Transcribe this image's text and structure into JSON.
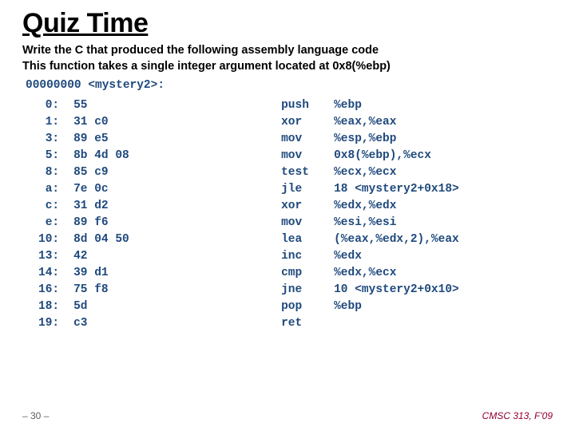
{
  "title": "Quiz Time",
  "intro": {
    "line1": "Write the C that produced the following assembly language code",
    "line2": "This function takes a single integer argument located at 0x8(%ebp)"
  },
  "symbol": "00000000 <mystery2>:",
  "asm": [
    {
      "off": "0:",
      "bytes": "55",
      "mnem": "push",
      "oper": "%ebp"
    },
    {
      "off": "1:",
      "bytes": "31 c0",
      "mnem": "xor",
      "oper": "%eax,%eax"
    },
    {
      "off": "3:",
      "bytes": "89 e5",
      "mnem": "mov",
      "oper": "%esp,%ebp"
    },
    {
      "off": "5:",
      "bytes": "8b 4d 08",
      "mnem": "mov",
      "oper": "0x8(%ebp),%ecx"
    },
    {
      "off": "8:",
      "bytes": "85 c9",
      "mnem": "test",
      "oper": "%ecx,%ecx"
    },
    {
      "off": "a:",
      "bytes": "7e 0c",
      "mnem": "jle",
      "oper": "18 <mystery2+0x18>"
    },
    {
      "off": "c:",
      "bytes": "31 d2",
      "mnem": "xor",
      "oper": "%edx,%edx"
    },
    {
      "off": "e:",
      "bytes": "89 f6",
      "mnem": "mov",
      "oper": "%esi,%esi"
    },
    {
      "off": "10:",
      "bytes": "8d 04 50",
      "mnem": "lea",
      "oper": "(%eax,%edx,2),%eax"
    },
    {
      "off": "13:",
      "bytes": "42",
      "mnem": "inc",
      "oper": "%edx"
    },
    {
      "off": "14:",
      "bytes": "39 d1",
      "mnem": "cmp",
      "oper": "%edx,%ecx"
    },
    {
      "off": "16:",
      "bytes": "75 f8",
      "mnem": "jne",
      "oper": "10 <mystery2+0x10>"
    },
    {
      "off": "18:",
      "bytes": "5d",
      "mnem": "pop",
      "oper": "%ebp"
    },
    {
      "off": "19:",
      "bytes": "c3",
      "mnem": "ret",
      "oper": ""
    }
  ],
  "footer": {
    "left": "– 30 –",
    "right": "CMSC 313, F'09"
  }
}
